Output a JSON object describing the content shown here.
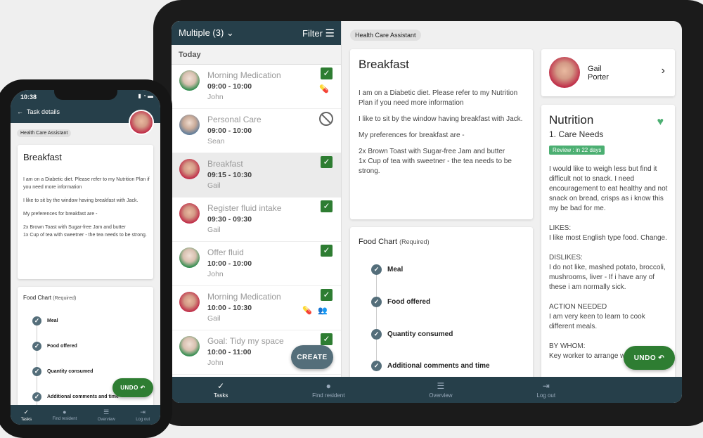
{
  "tablet": {
    "list_header": {
      "selector": "Multiple (3)",
      "filter": "Filter"
    },
    "section": "Today",
    "tasks": [
      {
        "title": "Morning Medication",
        "time": "09:00 - 10:00",
        "resident": "John",
        "status": "done",
        "icons": [
          "medication-icon"
        ]
      },
      {
        "title": "Personal Care",
        "time": "09:00 - 10:00",
        "resident": "Sean",
        "status": "refused",
        "icons": []
      },
      {
        "title": "Breakfast",
        "time": "09:15 - 10:30",
        "resident": "Gail",
        "status": "done",
        "selected": true,
        "icons": []
      },
      {
        "title": "Register fluid intake",
        "time": "09:30 - 09:30",
        "resident": "Gail",
        "status": "done",
        "icons": []
      },
      {
        "title": "Offer fluid",
        "time": "10:00 - 10:00",
        "resident": "John",
        "status": "done",
        "icons": []
      },
      {
        "title": "Morning Medication",
        "time": "10:00 - 10:30",
        "resident": "Gail",
        "status": "done",
        "icons": [
          "medication-icon",
          "group-icon"
        ]
      },
      {
        "title": "Goal: Tidy my space",
        "time": "10:00 - 11:00",
        "resident": "John",
        "status": "done",
        "icons": []
      }
    ],
    "create_label": "CREATE",
    "role_chip": "Health Care Assistant",
    "task": {
      "title": "Breakfast",
      "paragraphs": [
        "I am on a Diabetic diet. Please refer to my Nutrition Plan if you need more information",
        "I like to sit by the window having breakfast with Jack.",
        "My preferences for breakfast are -",
        "2x Brown Toast with Sugar-free Jam and butter\n1x Cup of tea with sweetner - the tea needs to be strong."
      ]
    },
    "food_chart": {
      "title": "Food Chart",
      "required": "(Required)",
      "steps": [
        "Meal",
        "Food offered",
        "Quantity consumed",
        "Additional comments and time"
      ]
    },
    "resident": {
      "first": "Gail",
      "last": "Porter"
    },
    "nutrition": {
      "title": "Nutrition",
      "subtitle": "1. Care Needs",
      "review": "Review : in 22 days",
      "body": "I would like to weigh less but find it difficult not to snack. I need encouragement to eat healthy and not snack on bread, crisps as i know this my be bad for me.\n\nLIKES:\nI like most English type food. Change.\n\nDISLIKES:\nI do not like, mashed potato, broccoli, mushrooms, liver - If i have any of these i am normally sick.\n\nACTION NEEDED\nI am very keen to learn to cook different meals.\n\nBY WHOM:\nKey worker to arrange with me . Staff"
    },
    "undo_label": "UNDO"
  },
  "nav": [
    "Tasks",
    "Find resident",
    "Overview",
    "Log out"
  ],
  "phone": {
    "time": "10:38",
    "header": "Task details",
    "role_chip": "Health Care Assistant",
    "undo_label": "UNDO"
  },
  "colors": {
    "primary_dark": "#263f4a",
    "success": "#2e7d32",
    "review": "#4caf72",
    "fab_create": "#546e7a"
  }
}
